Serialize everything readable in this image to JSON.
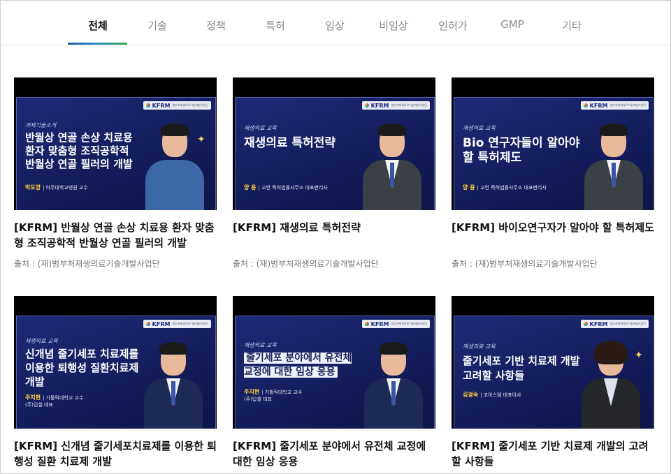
{
  "tabs": [
    "전체",
    "기술",
    "정책",
    "특허",
    "임상",
    "비임상",
    "인허가",
    "GMP",
    "기타"
  ],
  "active_tab": "전체",
  "logo_text": "KFRM",
  "logo_sub": "범부처재생의료기술개발사업단",
  "cards": [
    {
      "slide_tag": "과제기술소개",
      "slide_title": "반월상 연골 손상 치료용\n환자 맞춤형 조직공학적\n반월상 연골 필러의 개발",
      "speaker_name": "박도영",
      "speaker_info": "| 아주대학교병원 교수",
      "title": "[KFRM] 반월상 연골 손상 치료용 환자 맞춤형 조직공학적 반월상 연골 필러의 개발",
      "source": "출처 : (재)범부처재생의료기술개발사업단"
    },
    {
      "slide_tag": "재생의료 교육",
      "slide_title": "재생의료 특허전략",
      "speaker_name": "양 용",
      "speaker_info": "| 교연 특허법률사무소 대표변리사",
      "title": "[KFRM] 재생의료 특허전략",
      "source": "출처 : (재)범부처재생의료기술개발사업단"
    },
    {
      "slide_tag": "재생의료 교육",
      "slide_title": "Bio 연구자들이 알아야\n할 특허제도",
      "speaker_name": "양 용",
      "speaker_info": "| 교연 특허법률사무소 대표변리사",
      "title": "[KFRM] 바이오연구자가 알아야 할 특허제도",
      "source": "출처 : (재)범부처재생의료기술개발사업단"
    },
    {
      "slide_tag": "재생의료 교육",
      "slide_title": "신개념 줄기세포 치료제를\n이용한 퇴행성 질환치료제\n개발",
      "speaker_name": "주지현",
      "speaker_info": "| 가톨릭대학교 교수\n(주)입셀 대표",
      "title": "[KFRM] 신개념 줄기세포치료제를 이용한 퇴행성 질환 치료제 개발",
      "source": ""
    },
    {
      "slide_tag": "재생의료 교육",
      "slide_title": "줄기세포 분야에서 유전체\n교정에 대한 임상 응용",
      "speaker_name": "주지현",
      "speaker_info": "| 가톨릭대학교 교수\n(주)입셀 대표",
      "title": "[KFRM] 줄기세포 분야에서 유전체 교정에 대한 임상 응용",
      "source": ""
    },
    {
      "slide_tag": "재생의료 교육",
      "slide_title": "줄기세포 기반 치료제 개발\n고려할 사항들",
      "speaker_name": "김경숙",
      "speaker_info": "| 코아스템 대표이사",
      "title": "[KFRM] 줄기세포 기반 치료제 개발의 고려할 사항들",
      "source": ""
    }
  ]
}
